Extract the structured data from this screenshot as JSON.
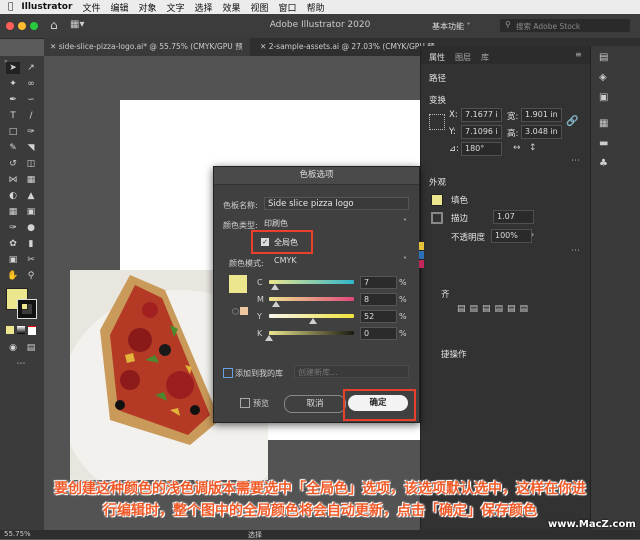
{
  "menubar": {
    "apple": "",
    "app": "Illustrator",
    "items": [
      "文件",
      "编辑",
      "对象",
      "文字",
      "选择",
      "效果",
      "视图",
      "窗口",
      "帮助"
    ]
  },
  "appbar": {
    "title": "Adobe Illustrator 2020",
    "workspace": "基本功能",
    "search_placeholder": "搜索 Adobe Stock"
  },
  "doc_tabs": [
    "side-slice-pizza-logo.ai* @ 55.75% (CMYK/GPU 预览)",
    "2-sample-assets.ai @ 27.03% (CMYK/GPU 预览)"
  ],
  "right_panel": {
    "tabs": [
      "属性",
      "图层",
      "库"
    ],
    "section_path": "路径",
    "section_transform": "变换",
    "x_label": "X:",
    "x_value": "7.1677 i",
    "y_label": "Y:",
    "y_value": "7.1096 i",
    "w_label": "宽:",
    "w_value": "1.901 in",
    "h_label": "高:",
    "h_value": "3.048 in",
    "angle_label": "⊿:",
    "angle_value": "180°",
    "appearance": "外观",
    "fill_label": "填色",
    "stroke_label": "描边",
    "stroke_value": "1.07",
    "opacity_label": "不透明度",
    "opacity_value": "100%",
    "align_hint": "齐",
    "quick_actions": "捷操作"
  },
  "dialog": {
    "title": "色板选项",
    "name_label": "色板名称:",
    "name_value": "Side slice pizza logo",
    "type_label": "颜色类型:",
    "type_value": "印刷色",
    "global_label": "全局色",
    "global_checked": true,
    "mode_label": "颜色模式:",
    "mode_value": "CMYK",
    "channels": [
      {
        "label": "C",
        "value": "7",
        "unit": "%",
        "level": 0.07
      },
      {
        "label": "M",
        "value": "8",
        "unit": "%",
        "level": 0.08
      },
      {
        "label": "Y",
        "value": "52",
        "unit": "%",
        "level": 0.52
      },
      {
        "label": "K",
        "value": "0",
        "unit": "%",
        "level": 0.0
      }
    ],
    "add_to_library": "添加到我的库",
    "create_library": "创建新库...",
    "preview": "预览",
    "cancel": "取消",
    "ok": "确定"
  },
  "caption": {
    "line1": "要创建这种颜色的浅色调版本需要选中「全局色」选项，该选项默认选中，这样在你进",
    "line2": "行编辑时，整个图中的全局颜色将会自动更新，点击「确定」保存颜色"
  },
  "status": {
    "zoom": "55.75%",
    "mode": "选择"
  },
  "watermark": "www.MacZ.com",
  "colors": {
    "swatch_yellow": "#ece68f",
    "accent_red": "#e8402a",
    "caption_orange": "#f05a28"
  }
}
